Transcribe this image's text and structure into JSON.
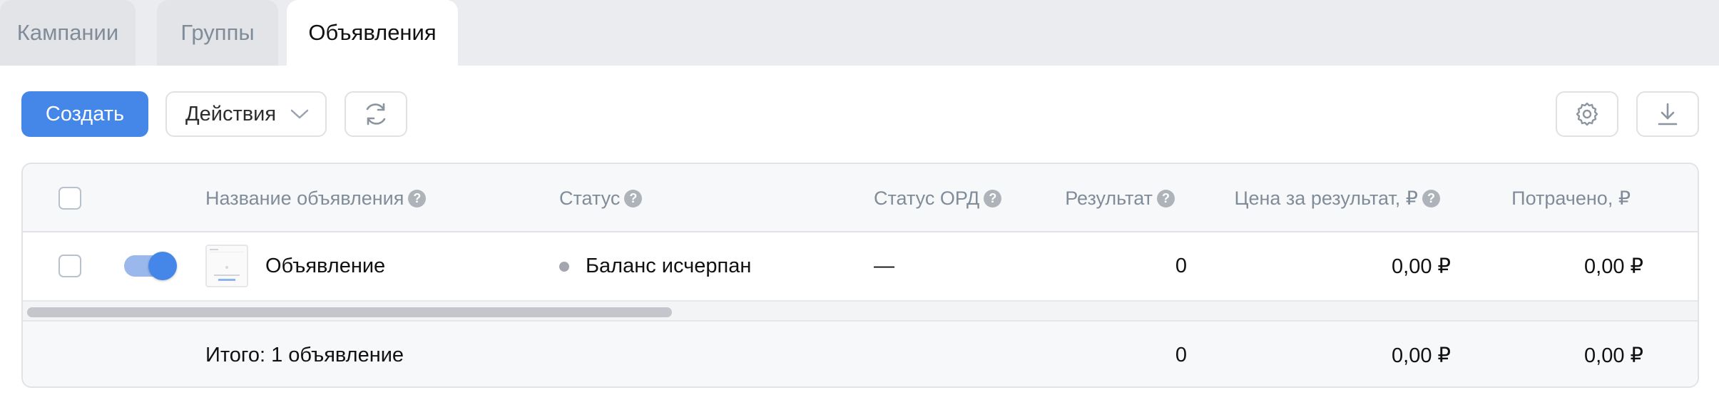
{
  "tabs": [
    {
      "label": "Кампании"
    },
    {
      "label": "Группы"
    },
    {
      "label": "Объявления"
    }
  ],
  "toolbar": {
    "create_label": "Создать",
    "actions_label": "Действия",
    "icons": {
      "refresh": "refresh-icon",
      "settings": "gear-icon",
      "download": "download-icon"
    }
  },
  "table": {
    "columns": [
      {
        "label": "Название объявления",
        "help": "?"
      },
      {
        "label": "Статус",
        "help": "?"
      },
      {
        "label": "Статус ОРД",
        "help": "?"
      },
      {
        "label": "Результат",
        "help": "?"
      },
      {
        "label": "Цена за результат, ₽",
        "help": "?"
      },
      {
        "label": "Потрачено, ₽"
      }
    ],
    "rows": [
      {
        "enabled": true,
        "name": "Объявление",
        "status": "Баланс исчерпан",
        "ord_status": "—",
        "result": "0",
        "cost_per_result": "0,00 ₽",
        "spent": "0,00 ₽"
      }
    ],
    "total": {
      "label": "Итого: 1 объявление",
      "result": "0",
      "cost_per_result": "0,00 ₽",
      "spent": "0,00 ₽"
    }
  },
  "colors": {
    "accent": "#4586e9",
    "status_dot": "#a3a7ad"
  }
}
